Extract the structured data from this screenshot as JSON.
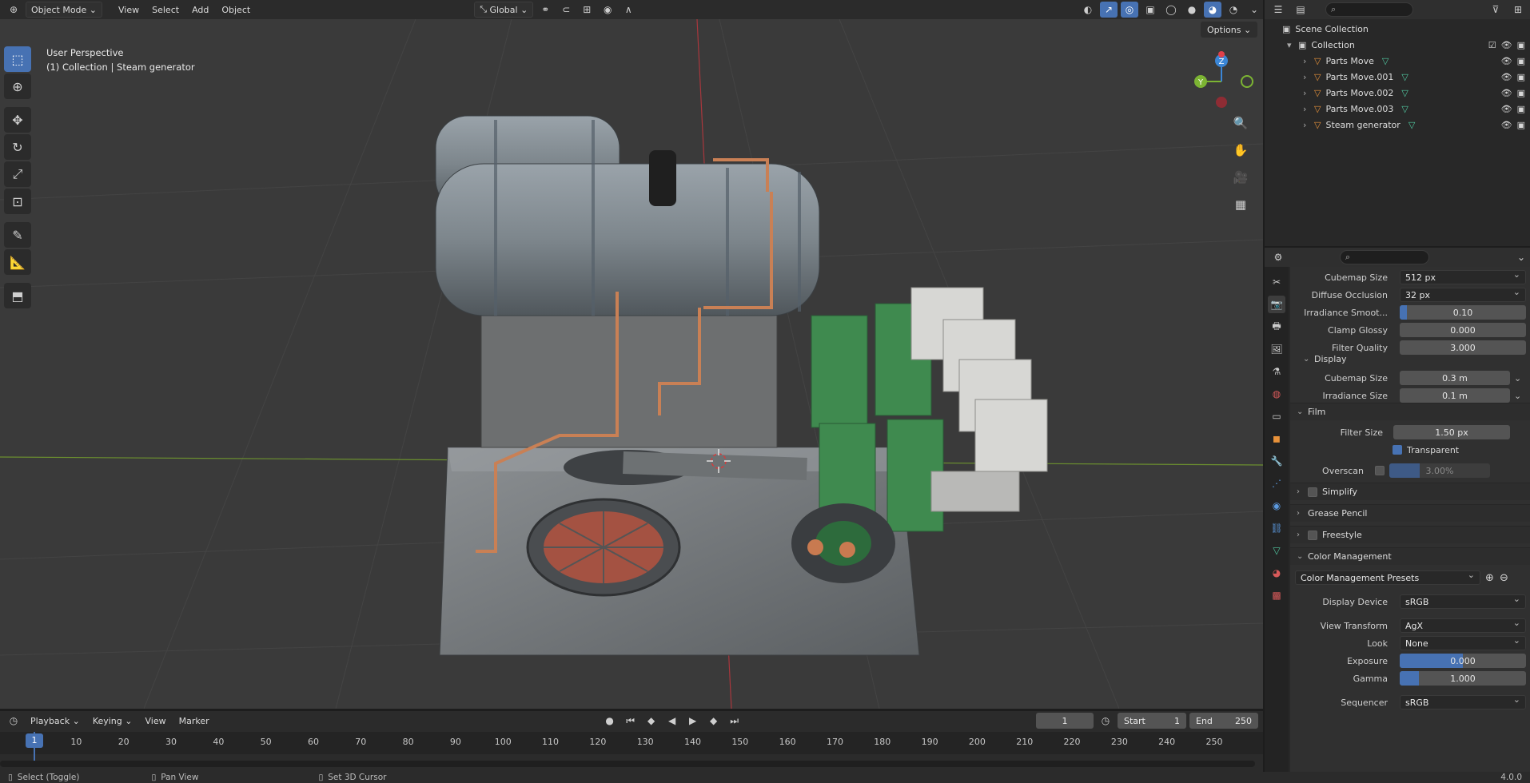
{
  "viewport": {
    "mode": "Object Mode",
    "menu": [
      "View",
      "Select",
      "Add",
      "Object"
    ],
    "orientation": "Global",
    "perspective_label": "User Perspective",
    "context_label": "(1) Collection | Steam generator",
    "options_label": "Options",
    "gizmo_axes": [
      "X",
      "Y",
      "Z"
    ]
  },
  "timeline": {
    "playback_label": "Playback",
    "keying_label": "Keying",
    "view_label": "View",
    "marker_label": "Marker",
    "current_frame": "1",
    "start_label": "Start",
    "start_value": "1",
    "end_label": "End",
    "end_value": "250",
    "ruler_ticks": [
      "10",
      "20",
      "30",
      "40",
      "50",
      "60",
      "70",
      "80",
      "90",
      "100",
      "110",
      "120",
      "130",
      "140",
      "150",
      "160",
      "170",
      "180",
      "190",
      "200",
      "210",
      "220",
      "230",
      "240",
      "250"
    ],
    "playhead_label": "1"
  },
  "statusbar": {
    "select": "Select (Toggle)",
    "pan": "Pan View",
    "cursor": "Set 3D Cursor",
    "version": "4.0.0"
  },
  "outliner": {
    "scene_collection": "Scene Collection",
    "collection": "Collection",
    "items": [
      {
        "label": "Parts Move"
      },
      {
        "label": "Parts Move.001"
      },
      {
        "label": "Parts Move.002"
      },
      {
        "label": "Parts Move.003"
      },
      {
        "label": "Steam generator"
      }
    ]
  },
  "properties": {
    "rows_top": [
      {
        "label": "Cubemap Size",
        "value": "512 px",
        "type": "dropdown"
      },
      {
        "label": "Diffuse Occlusion",
        "value": "32 px",
        "type": "dropdown"
      },
      {
        "label": "Irradiance Smoot...",
        "value": "0.10",
        "type": "slider",
        "fill": 0.06
      },
      {
        "label": "Clamp Glossy",
        "value": "0.000",
        "type": "number"
      },
      {
        "label": "Filter Quality",
        "value": "3.000",
        "type": "number"
      }
    ],
    "display_panel": {
      "title": "Display",
      "rows": [
        {
          "label": "Cubemap Size",
          "value": "0.3 m"
        },
        {
          "label": "Irradiance Size",
          "value": "0.1 m"
        }
      ]
    },
    "film_panel": {
      "title": "Film",
      "filter_size_label": "Filter Size",
      "filter_size_value": "1.50 px",
      "transparent_label": "Transparent",
      "overscan_label": "Overscan",
      "overscan_value": "3.00%"
    },
    "panels": {
      "simplify": "Simplify",
      "grease_pencil": "Grease Pencil",
      "freestyle": "Freestyle",
      "color_management": "Color Management"
    },
    "color_management": {
      "presets_label": "Color Management Presets",
      "display_device_label": "Display Device",
      "display_device_value": "sRGB",
      "view_transform_label": "View Transform",
      "view_transform_value": "AgX",
      "look_label": "Look",
      "look_value": "None",
      "exposure_label": "Exposure",
      "exposure_value": "0.000",
      "exposure_fill": 0.5,
      "gamma_label": "Gamma",
      "gamma_value": "1.000",
      "gamma_fill": 0.15,
      "sequencer_label": "Sequencer",
      "sequencer_value": "sRGB"
    }
  },
  "colors": {
    "accent": "#4772b3",
    "x_axis": "#e0414b",
    "y_axis": "#7cb433",
    "z_axis": "#3b86d6"
  }
}
